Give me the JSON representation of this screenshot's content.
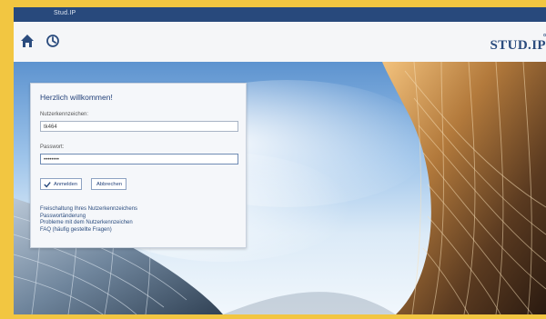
{
  "topbar": {
    "brand": "Stud.IP"
  },
  "header": {
    "home_icon": "home-icon",
    "history_icon": "clock-icon",
    "logo": "STUD.IP"
  },
  "login": {
    "title": "Herzlich willkommen!",
    "username_label": "Nutzerkennzeichen:",
    "username_value": "tk464",
    "password_label": "Passwort:",
    "password_value": "••••••••",
    "login_button": "Anmelden",
    "cancel_button": "Abbrechen",
    "links": [
      "Freischaltung Ihres Nutzerkennzeichens",
      "Passwortänderung",
      "Probleme mit dem Nutzerkennzeichen",
      "FAQ (häufig gestellte Fragen)"
    ]
  }
}
